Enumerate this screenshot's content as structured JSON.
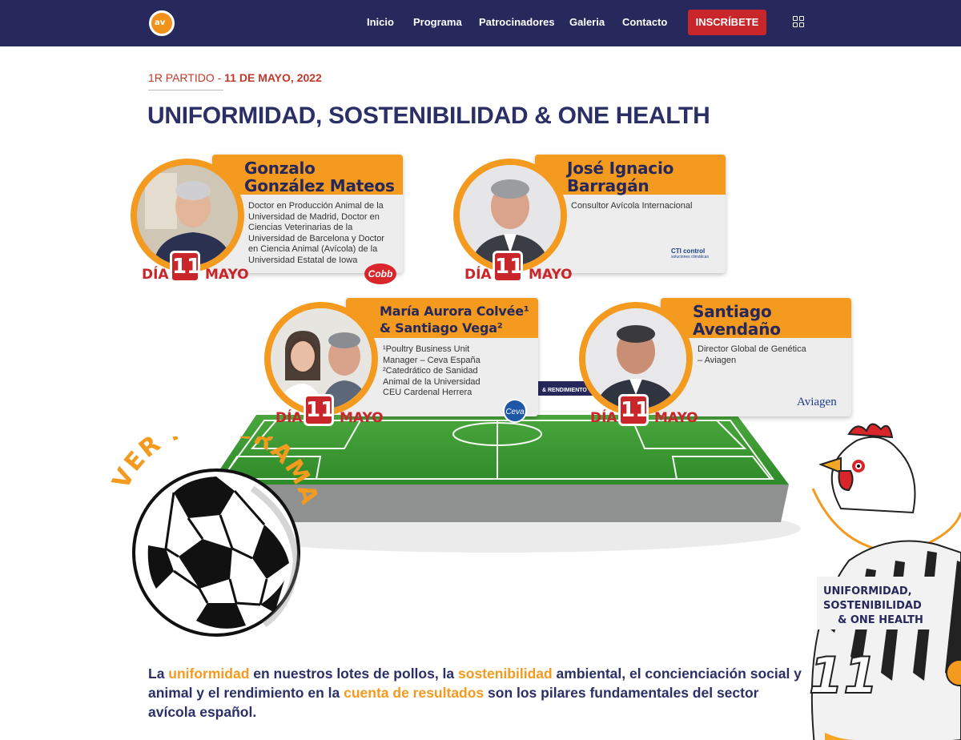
{
  "nav": {
    "logo_text": "av",
    "items": [
      "Inicio",
      "Programa",
      "Patrocinadores",
      "Galeria",
      "Contacto"
    ],
    "cta": "INSCRÍBETE"
  },
  "section": {
    "kicker_prefix": "1R PARTIDO - ",
    "kicker_date": "11 DE MAYO, 2022",
    "title": "UNIFORMIDAD, SOSTENIBILIDAD & ONE HEALTH"
  },
  "speakers": [
    {
      "name_line1": "Gonzalo",
      "name_line2": "González Mateos",
      "desc": [
        "Doctor en Producción Animal de la",
        "Universidad de Madrid, Doctor en",
        "Ciencias Veterinarias de la",
        "Universidad de Barcelona y Doctor",
        "en Ciencia Animal (Avícola) de la",
        "Universidad Estatal de Iowa"
      ],
      "day_label": "DÍA",
      "day": "11",
      "month": "MAYO",
      "sponsor": "Cobb"
    },
    {
      "name_line1": "José Ignacio",
      "name_line2": "Barragán",
      "desc": [
        "Consultor Avícola Internacional"
      ],
      "day_label": "DÍA",
      "day": "11",
      "month": "MAYO",
      "sponsor": "CTI control",
      "sponsor_sub": "soluciones climáticas"
    },
    {
      "name_line1": "María Aurora Colvée¹",
      "name_line2": "& Santiago Vega²",
      "desc": [
        "¹Poultry Business Unit",
        "Manager – Ceva España",
        "²Catedrático de Sanidad",
        "Animal de la Universidad",
        "CEU Cardenal Herrera"
      ],
      "day_label": "DÍA",
      "day": "11",
      "month": "MAYO",
      "sponsor": "Ceva"
    },
    {
      "name_line1": "Santiago",
      "name_line2": "Avendaño",
      "desc": [
        "Director Global de Genética",
        "– Aviagen"
      ],
      "day_label": "DÍA",
      "day": "11",
      "month": "MAYO",
      "sponsor": "Aviagen"
    }
  ],
  "field_banner": "& RENDIMIENTO",
  "ball_text": "VER PROGRAMA",
  "mascot": {
    "shirt_text": [
      "UNIFORMIDAD,",
      "SOSTENIBILIDAD",
      "& ONE HEALTH"
    ],
    "number": "11"
  },
  "intro": {
    "p1": "La ",
    "h1": "uniformidad",
    "p2": " en nuestros lotes de pollos, la ",
    "h2": "sostenibilidad",
    "p3": " ambiental, el concienciación social y animal y el rendimiento en la ",
    "h3": "cuenta de resultados",
    "p4": " son los pilares fundamentales del sector avícola español."
  },
  "colors": {
    "navy": "#27285c",
    "orange": "#f39a1f",
    "red": "#c8262a",
    "field": "#3f9b35"
  }
}
